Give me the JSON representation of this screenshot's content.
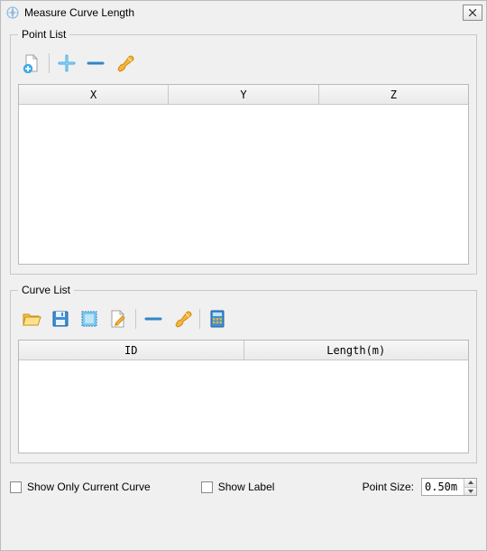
{
  "window": {
    "title": "Measure Curve Length"
  },
  "point_list": {
    "legend": "Point List",
    "columns": [
      "X",
      "Y",
      "Z"
    ],
    "rows": [],
    "tools": {
      "new_file": "new-page-icon",
      "add": "plus-icon",
      "remove": "minus-icon",
      "clear": "brush-icon"
    }
  },
  "curve_list": {
    "legend": "Curve List",
    "columns": [
      "ID",
      "Length(m)"
    ],
    "rows": [],
    "tools": {
      "open": "folder-open-icon",
      "save": "save-icon",
      "select_rect": "select-rect-icon",
      "edit": "edit-page-icon",
      "remove": "minus-icon",
      "clear": "brush-icon",
      "calc": "calculator-icon"
    }
  },
  "footer": {
    "show_only_current": {
      "label": "Show Only Current Curve",
      "checked": false
    },
    "show_label": {
      "label": "Show Label",
      "checked": false
    },
    "point_size_label": "Point Size:",
    "point_size_value": "0.50m"
  }
}
